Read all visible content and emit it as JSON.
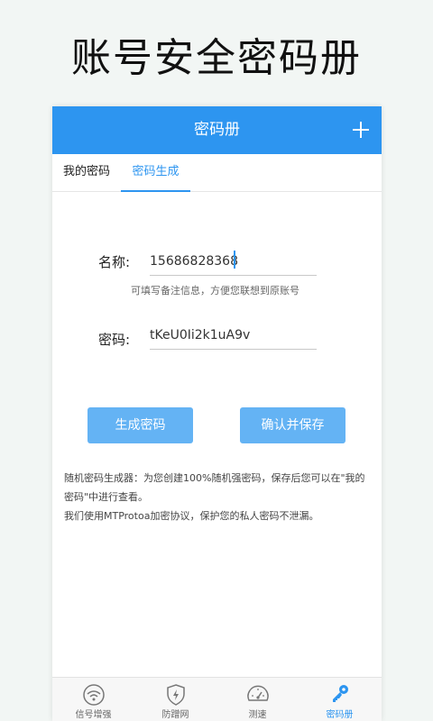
{
  "headline": "账号安全密码册",
  "app": {
    "title": "密码册",
    "add_icon": "plus-icon"
  },
  "tabs": [
    {
      "label": "我的密码",
      "active": false
    },
    {
      "label": "密码生成",
      "active": true
    }
  ],
  "form": {
    "name_label": "名称:",
    "name_value": "15686828368",
    "name_hint": "可填写备注信息，方便您联想到原账号",
    "password_label": "密码:",
    "password_value": "tKeU0Ii2k1uA9v"
  },
  "buttons": {
    "generate": "生成密码",
    "confirm_save": "确认并保存"
  },
  "description": {
    "line1": "随机密码生成器：为您创建100%随机强密码，保存后您可以在\"我的",
    "line2": "密码\"中进行查看。",
    "line3": "我们使用MTProtoa加密协议，保护您的私人密码不泄漏。"
  },
  "bottom_nav": [
    {
      "label": "信号增强",
      "icon": "wifi-signal-icon",
      "active": false
    },
    {
      "label": "防蹭网",
      "icon": "shield-bolt-icon",
      "active": false
    },
    {
      "label": "测速",
      "icon": "speedometer-icon",
      "active": false
    },
    {
      "label": "密码册",
      "icon": "key-icon",
      "active": true
    }
  ],
  "colors": {
    "accent": "#2d95f0",
    "button": "#64b3f4"
  }
}
